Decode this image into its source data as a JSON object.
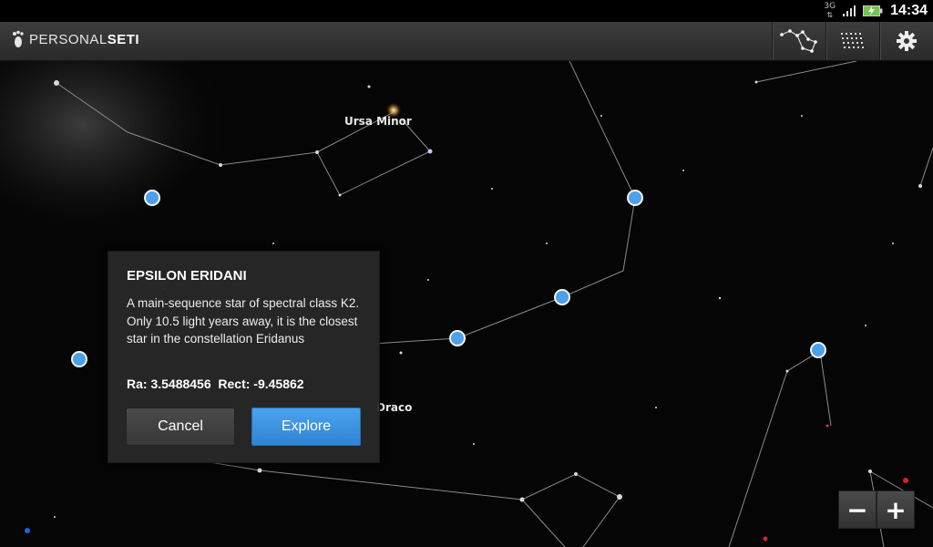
{
  "status": {
    "network": "3G",
    "time": "14:34"
  },
  "app": {
    "brand_light": "PERSONAL",
    "brand_bold": "SETI",
    "actions": [
      {
        "name": "constellations-toggle",
        "icon": "constellation-icon"
      },
      {
        "name": "grid-toggle",
        "icon": "grid-icon"
      },
      {
        "name": "settings",
        "icon": "gear-icon"
      }
    ]
  },
  "sky": {
    "constellation_labels": [
      "Ursa Minor",
      "Draco"
    ]
  },
  "dialog": {
    "title": "EPSILON ERIDANI",
    "description": "A main-sequence star of spectral class K2. Only 10.5 light years away, it is the closest star in the constellation Eridanus",
    "coords": "Ra: 3.5488456  Rect: -9.45862",
    "cancel_label": "Cancel",
    "explore_label": "Explore"
  },
  "zoom": {
    "out_label": "−",
    "in_label": "+"
  },
  "colors": {
    "accent": "#4da0ea",
    "marker_border": "#f4f4f4"
  }
}
